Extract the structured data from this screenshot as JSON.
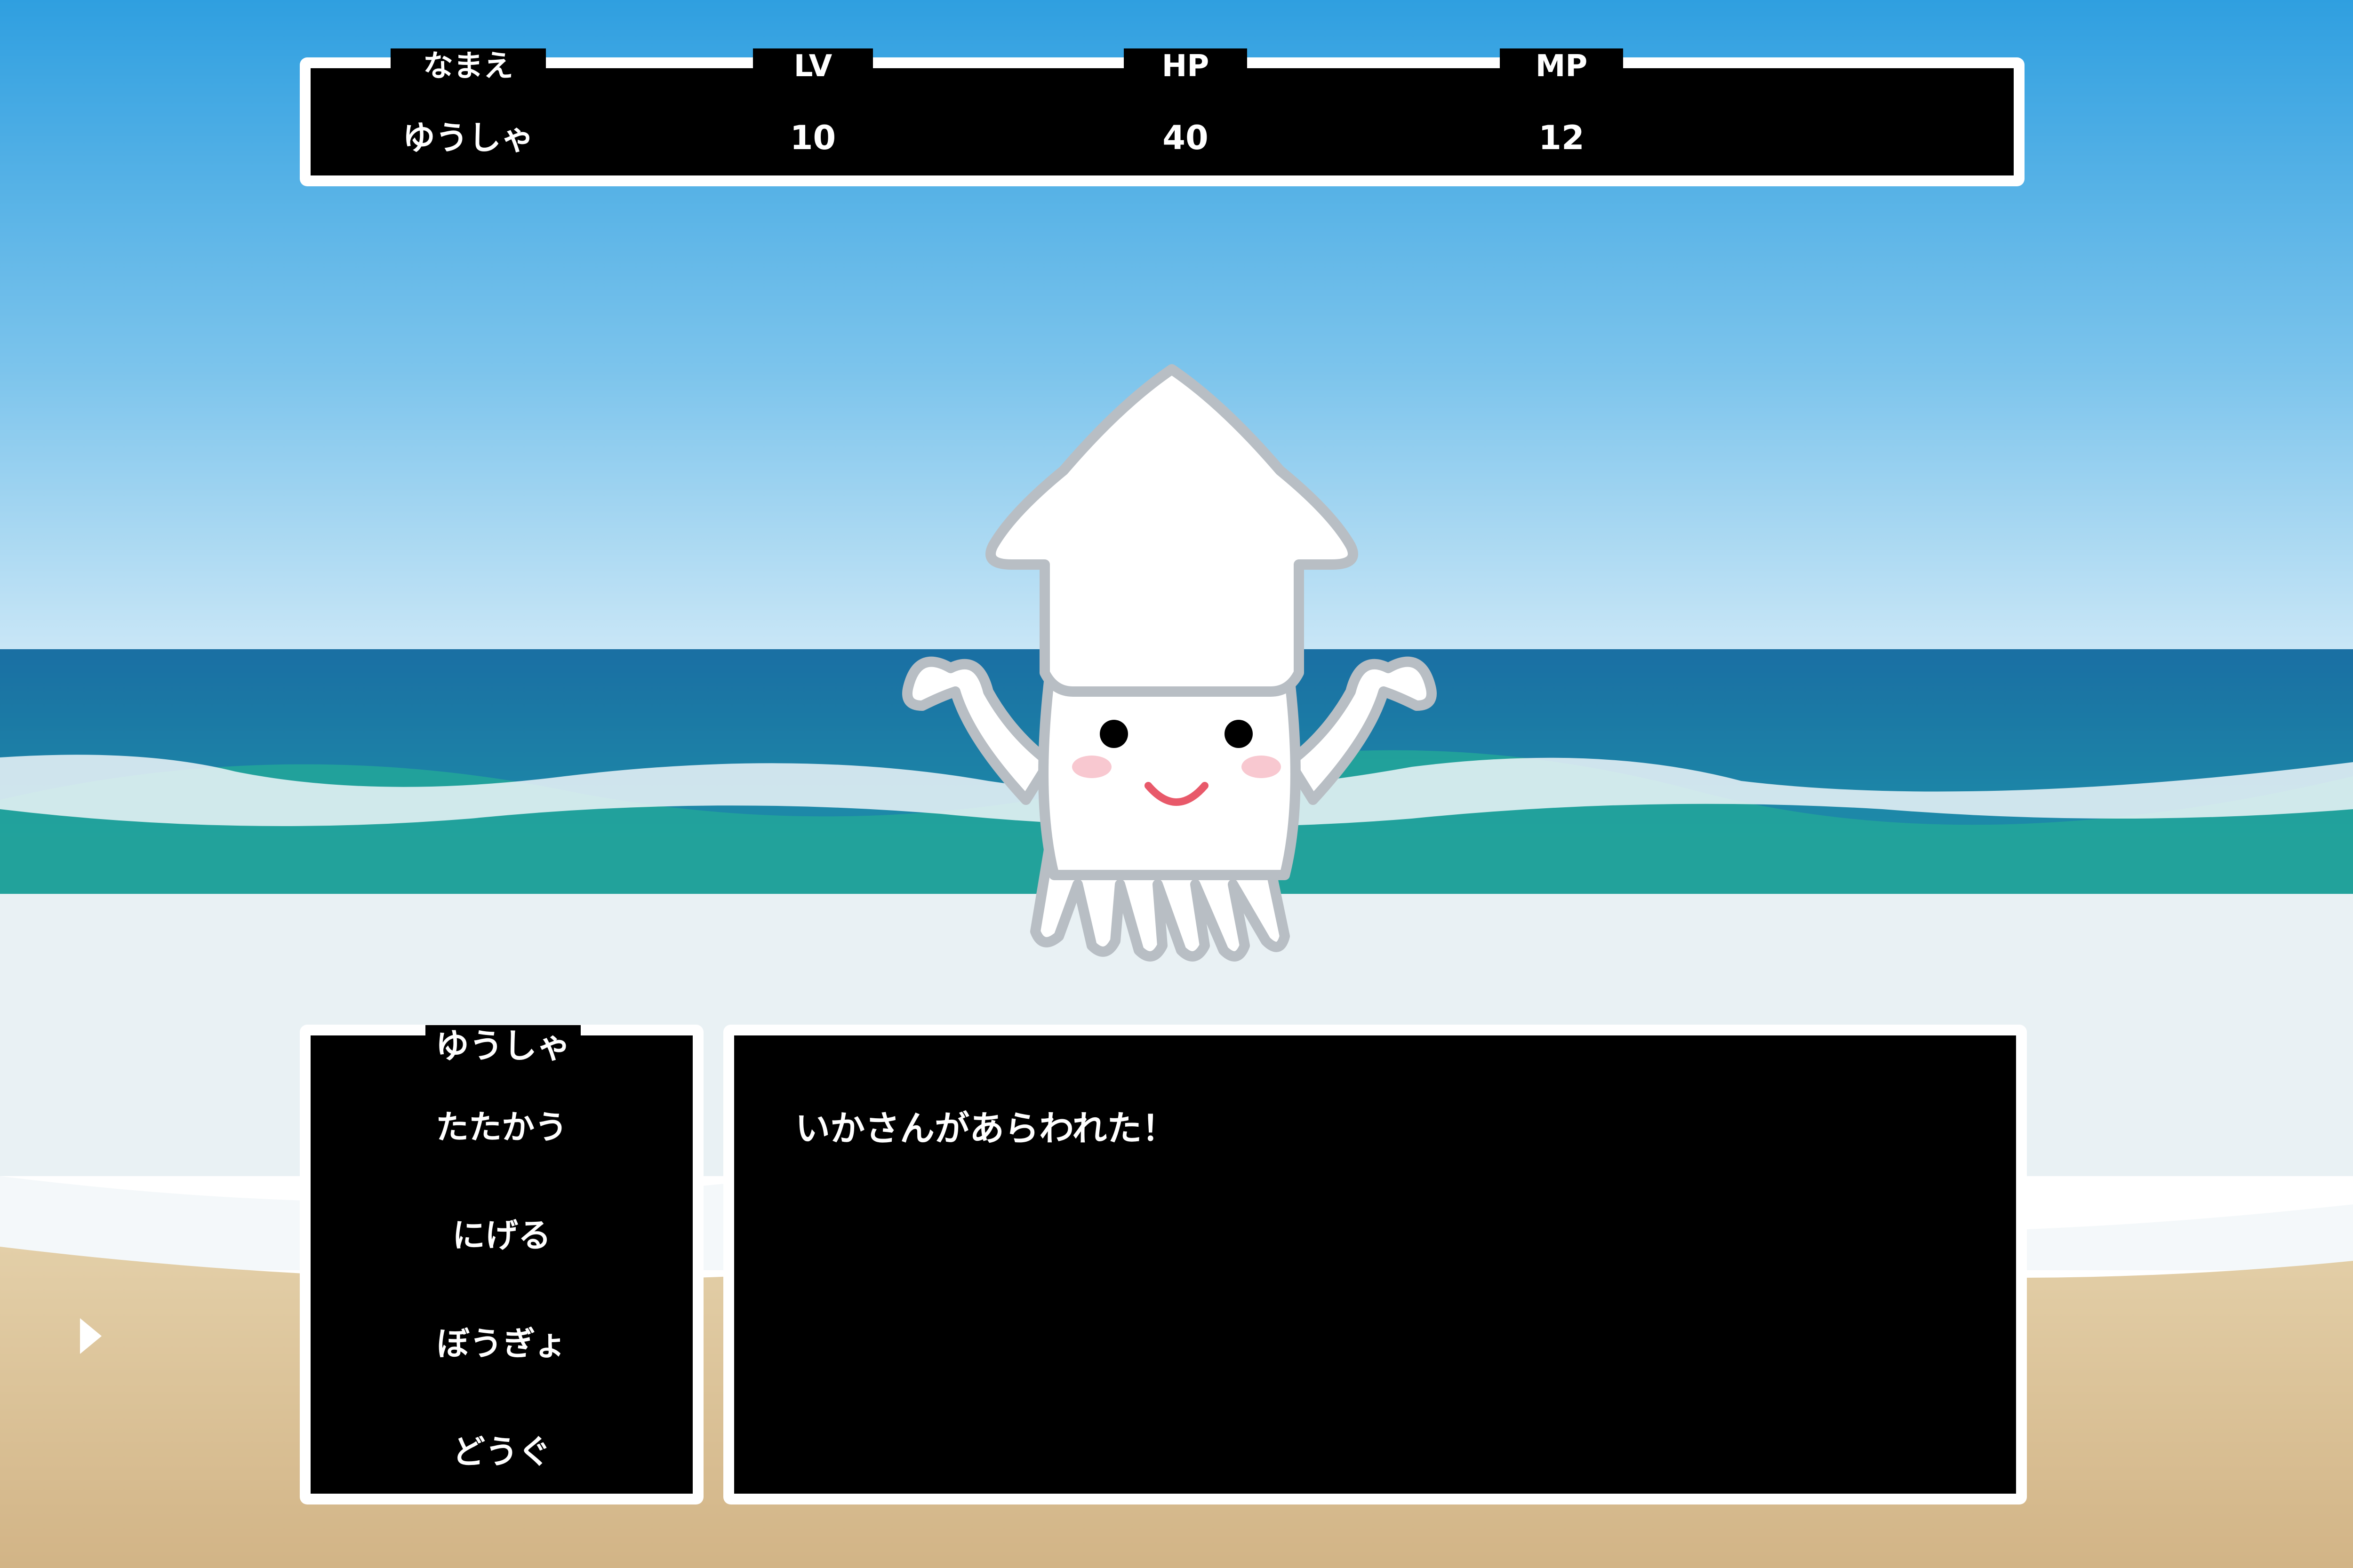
{
  "status": {
    "name_label": "なまえ",
    "lv_label": "LV",
    "hp_label": "HP",
    "mp_label": "MP",
    "name": "ゆうしゃ",
    "lv": "10",
    "hp": "40",
    "mp": "12"
  },
  "command": {
    "title": "ゆうしゃ",
    "items": [
      "たたかう",
      "にげる",
      "ぼうぎょ",
      "どうぐ"
    ],
    "selected_index": 2
  },
  "message": {
    "text": "いかさんがあらわれた！"
  },
  "enemy": {
    "icon": "squid-icon"
  },
  "colors": {
    "window_bg": "#000000",
    "window_border": "#ffffff",
    "text": "#ffffff",
    "sky_top": "#2f9fe0",
    "sea": "#1a6fa3",
    "sand": "#dcc39a"
  }
}
